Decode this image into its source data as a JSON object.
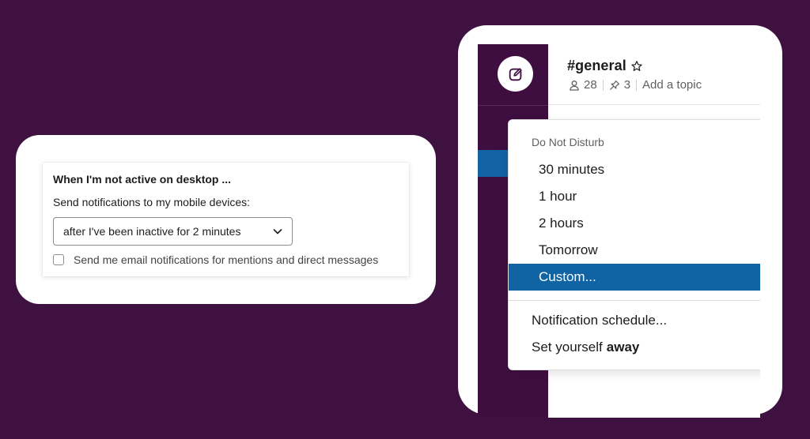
{
  "notifications_card": {
    "title": "When I'm not active on desktop ...",
    "subtitle": "Send notifications to my mobile devices:",
    "select_value": "after I've been inactive for 2 minutes",
    "checkbox_label": "Send me email notifications for mentions and direct messages",
    "checkbox_checked": false
  },
  "channel": {
    "name": "#general",
    "member_count": "28",
    "pinned_count": "3",
    "add_topic": "Add a topic"
  },
  "dnd_menu": {
    "heading": "Do Not Disturb",
    "options": [
      "30 minutes",
      "1 hour",
      "2 hours",
      "Tomorrow",
      "Custom..."
    ],
    "highlighted": "Custom...",
    "schedule": "Notification schedule...",
    "away_prefix": "Set yourself",
    "away_bold": "away"
  },
  "colors": {
    "background": "#3f1140",
    "sidebar": "#3f0e40",
    "accent": "#1164a3"
  },
  "icons": [
    "chevron-down-icon",
    "compose-icon",
    "star-icon",
    "members-icon",
    "pin-icon"
  ]
}
